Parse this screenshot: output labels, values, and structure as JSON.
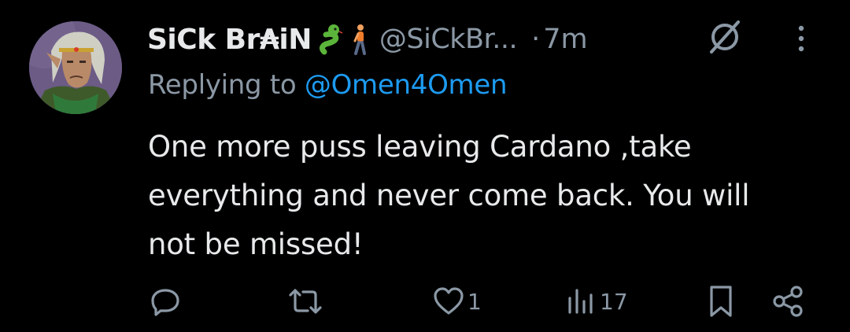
{
  "author": {
    "display_name": "SiCk Br₳iN",
    "handle": "@SiCkBr...",
    "separator": "·",
    "timestamp": "7m"
  },
  "reply": {
    "prefix": "Replying to ",
    "mention": "@Omen4Omen"
  },
  "tweet": {
    "lines": [
      "One more puss leaving Cardano ,take",
      "everything and never come back. You will",
      "not be missed!"
    ]
  },
  "actions": {
    "reply_count": "",
    "retweet_count": "",
    "like_count": "1",
    "views_count": "17"
  },
  "icons": {
    "emoji_1": "snake-emoji",
    "emoji_2": "walking-person-emoji",
    "status": "no-sign-icon",
    "menu": "more-options-icon"
  },
  "colors": {
    "background": "#000000",
    "text": "#e7e9ea",
    "muted": "#8b98a5",
    "link": "#1d9bf0"
  }
}
